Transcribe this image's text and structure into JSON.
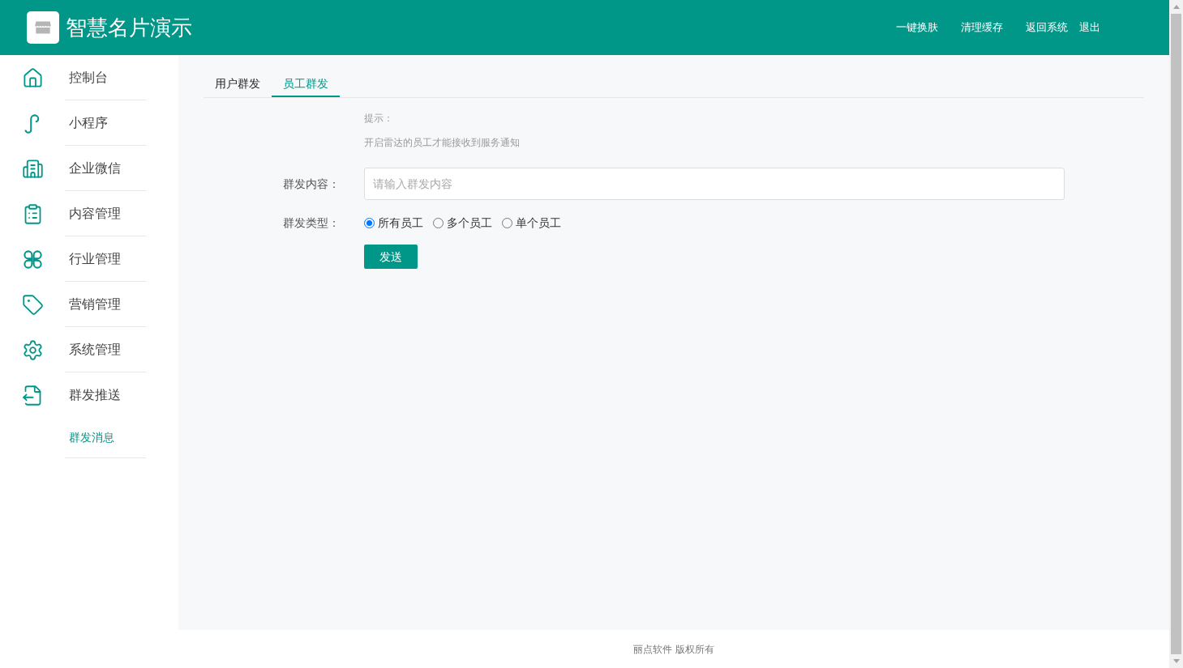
{
  "header": {
    "title": "智慧名片演示",
    "links": [
      "一键换肤",
      "清理缓存",
      "返回系统",
      "退出"
    ]
  },
  "sidebar": {
    "items": [
      {
        "label": "控制台",
        "selected": false
      },
      {
        "label": "小程序",
        "selected": false
      },
      {
        "label": "企业微信",
        "selected": false
      },
      {
        "label": "内容管理",
        "selected": false
      },
      {
        "label": "行业管理",
        "selected": false
      },
      {
        "label": "营销管理",
        "selected": false
      },
      {
        "label": "系统管理",
        "selected": false
      },
      {
        "label": "群发推送",
        "selected": false,
        "children": [
          {
            "label": "群发消息",
            "selected": true
          }
        ]
      }
    ]
  },
  "tabs": [
    {
      "label": "用户群发",
      "selected": false
    },
    {
      "label": "员工群发",
      "selected": true
    }
  ],
  "form": {
    "hint_title": "提示：",
    "hint_text": "开启雷达的员工才能接收到服务通知",
    "content": {
      "label": "群发内容：",
      "placeholder": "请输入群发内容"
    },
    "type": {
      "label": "群发类型：",
      "options": [
        {
          "label": "所有员工",
          "selected": true
        },
        {
          "label": "多个员工",
          "selected": false
        },
        {
          "label": "单个员工",
          "selected": false
        }
      ]
    },
    "submit": "发送"
  },
  "footer": "丽点软件 版权所有"
}
